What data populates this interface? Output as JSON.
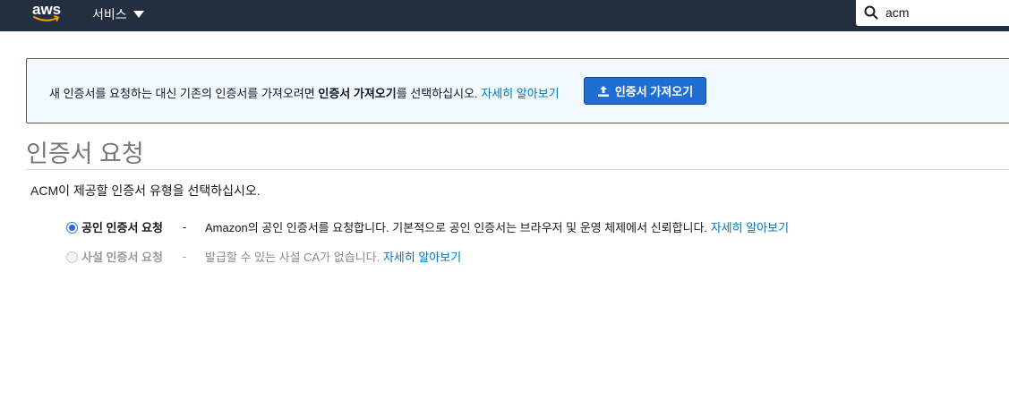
{
  "topnav": {
    "logo_text": "aws",
    "services_label": "서비스",
    "search_value": "acm"
  },
  "banner": {
    "text_before": "새 인증서를 요청하는 대신 기존의 인증서를 가져오려면 ",
    "text_bold": "인증서 가져오기",
    "text_after": "를 선택하십시오. ",
    "learn_more": "자세히 알아보기",
    "import_button": "인증서 가져오기"
  },
  "page": {
    "title": "인증서 요청",
    "description": "ACM이 제공할 인증서 유형을 선택하십시오."
  },
  "options": [
    {
      "label": "공인 인증서 요청",
      "dash": "-",
      "description": "Amazon의 공인 인증서를 요청합니다. 기본적으로 공인 인증서는 브라우저 및 운영 체제에서 신뢰합니다. ",
      "learn_more": "자세히 알아보기",
      "selected": true,
      "disabled": false
    },
    {
      "label": "사설 인증서 요청",
      "dash": "-",
      "description": "발급할 수 있는 사설 CA가 없습니다. ",
      "learn_more": "자세히 알아보기",
      "selected": false,
      "disabled": true
    }
  ],
  "colors": {
    "nav_bg": "#232f3e",
    "link": "#0073bb",
    "primary_button": "#1f6ed4",
    "banner_bg": "#f1faff"
  },
  "icons": [
    "aws-logo-smile",
    "chevron-down-icon",
    "search-icon",
    "upload-icon"
  ]
}
